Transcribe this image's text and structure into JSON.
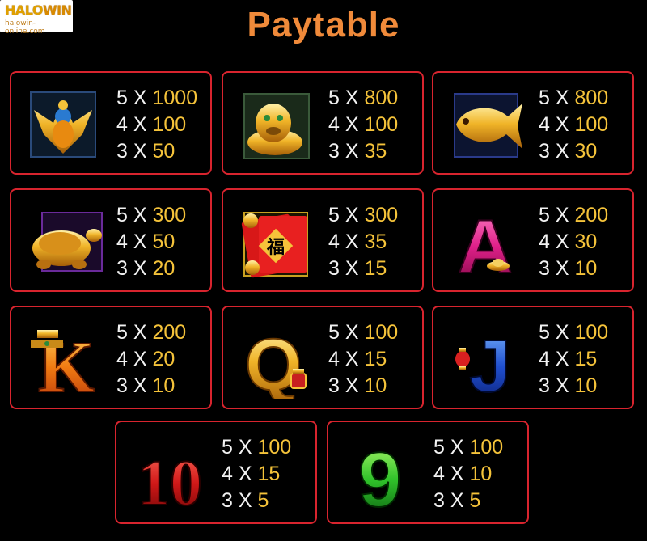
{
  "logo": {
    "main_a": "HALO",
    "main_b": "WIN",
    "url": "halowin-online.com"
  },
  "title": "Paytable",
  "cards": [
    {
      "symbol": "phoenix-icon",
      "pays": [
        {
          "count": "5 X",
          "value": "1000"
        },
        {
          "count": "4 X",
          "value": "100"
        },
        {
          "count": "3 X",
          "value": "50"
        }
      ]
    },
    {
      "symbol": "lion-icon",
      "pays": [
        {
          "count": "5 X",
          "value": "800"
        },
        {
          "count": "4 X",
          "value": "100"
        },
        {
          "count": "3 X",
          "value": "35"
        }
      ]
    },
    {
      "symbol": "koi-icon",
      "pays": [
        {
          "count": "5 X",
          "value": "800"
        },
        {
          "count": "4 X",
          "value": "100"
        },
        {
          "count": "3 X",
          "value": "30"
        }
      ]
    },
    {
      "symbol": "turtle-icon",
      "pays": [
        {
          "count": "5 X",
          "value": "300"
        },
        {
          "count": "4 X",
          "value": "50"
        },
        {
          "count": "3 X",
          "value": "20"
        }
      ]
    },
    {
      "symbol": "red-envelope-icon",
      "glyph": "福",
      "pays": [
        {
          "count": "5 X",
          "value": "300"
        },
        {
          "count": "4 X",
          "value": "35"
        },
        {
          "count": "3 X",
          "value": "15"
        }
      ]
    },
    {
      "symbol": "letter-a-icon",
      "glyph": "A",
      "pays": [
        {
          "count": "5 X",
          "value": "200"
        },
        {
          "count": "4 X",
          "value": "30"
        },
        {
          "count": "3 X",
          "value": "10"
        }
      ]
    },
    {
      "symbol": "letter-k-icon",
      "glyph": "K",
      "pays": [
        {
          "count": "5 X",
          "value": "200"
        },
        {
          "count": "4 X",
          "value": "20"
        },
        {
          "count": "3 X",
          "value": "10"
        }
      ]
    },
    {
      "symbol": "letter-q-icon",
      "glyph": "Q",
      "pays": [
        {
          "count": "5 X",
          "value": "100"
        },
        {
          "count": "4 X",
          "value": "15"
        },
        {
          "count": "3 X",
          "value": "10"
        }
      ]
    },
    {
      "symbol": "letter-j-icon",
      "glyph": "J",
      "pays": [
        {
          "count": "5 X",
          "value": "100"
        },
        {
          "count": "4 X",
          "value": "15"
        },
        {
          "count": "3 X",
          "value": "10"
        }
      ]
    },
    {
      "symbol": "number-10-icon",
      "glyph": "10",
      "pays": [
        {
          "count": "5 X",
          "value": "100"
        },
        {
          "count": "4 X",
          "value": "15"
        },
        {
          "count": "3 X",
          "value": "5"
        }
      ]
    },
    {
      "symbol": "number-9-icon",
      "glyph": "9",
      "pays": [
        {
          "count": "5 X",
          "value": "100"
        },
        {
          "count": "4 X",
          "value": "10"
        },
        {
          "count": "3 X",
          "value": "5"
        }
      ]
    }
  ],
  "colors": {
    "border": "#d8242e",
    "title": "#f08a3a",
    "value": "#f5c33a",
    "count": "#f2f2f2"
  }
}
